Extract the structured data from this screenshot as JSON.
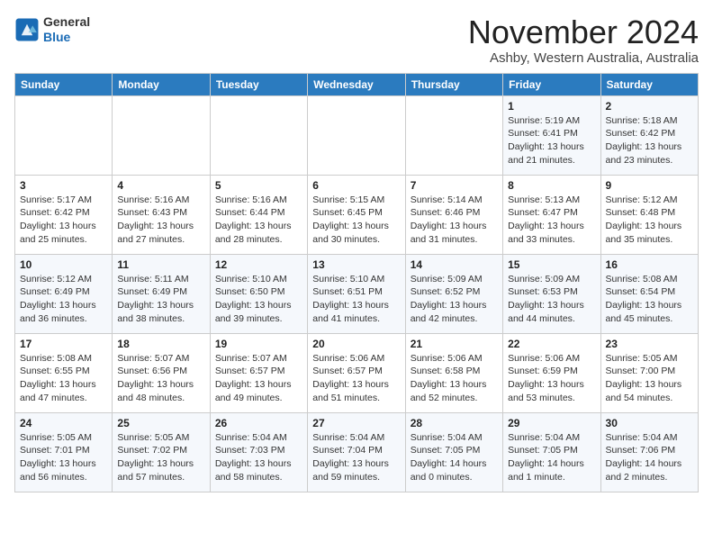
{
  "header": {
    "logo_line1": "General",
    "logo_line2": "Blue",
    "month": "November 2024",
    "location": "Ashby, Western Australia, Australia"
  },
  "days_of_week": [
    "Sunday",
    "Monday",
    "Tuesday",
    "Wednesday",
    "Thursday",
    "Friday",
    "Saturday"
  ],
  "weeks": [
    [
      {
        "day": "",
        "info": ""
      },
      {
        "day": "",
        "info": ""
      },
      {
        "day": "",
        "info": ""
      },
      {
        "day": "",
        "info": ""
      },
      {
        "day": "",
        "info": ""
      },
      {
        "day": "1",
        "info": "Sunrise: 5:19 AM\nSunset: 6:41 PM\nDaylight: 13 hours\nand 21 minutes."
      },
      {
        "day": "2",
        "info": "Sunrise: 5:18 AM\nSunset: 6:42 PM\nDaylight: 13 hours\nand 23 minutes."
      }
    ],
    [
      {
        "day": "3",
        "info": "Sunrise: 5:17 AM\nSunset: 6:42 PM\nDaylight: 13 hours\nand 25 minutes."
      },
      {
        "day": "4",
        "info": "Sunrise: 5:16 AM\nSunset: 6:43 PM\nDaylight: 13 hours\nand 27 minutes."
      },
      {
        "day": "5",
        "info": "Sunrise: 5:16 AM\nSunset: 6:44 PM\nDaylight: 13 hours\nand 28 minutes."
      },
      {
        "day": "6",
        "info": "Sunrise: 5:15 AM\nSunset: 6:45 PM\nDaylight: 13 hours\nand 30 minutes."
      },
      {
        "day": "7",
        "info": "Sunrise: 5:14 AM\nSunset: 6:46 PM\nDaylight: 13 hours\nand 31 minutes."
      },
      {
        "day": "8",
        "info": "Sunrise: 5:13 AM\nSunset: 6:47 PM\nDaylight: 13 hours\nand 33 minutes."
      },
      {
        "day": "9",
        "info": "Sunrise: 5:12 AM\nSunset: 6:48 PM\nDaylight: 13 hours\nand 35 minutes."
      }
    ],
    [
      {
        "day": "10",
        "info": "Sunrise: 5:12 AM\nSunset: 6:49 PM\nDaylight: 13 hours\nand 36 minutes."
      },
      {
        "day": "11",
        "info": "Sunrise: 5:11 AM\nSunset: 6:49 PM\nDaylight: 13 hours\nand 38 minutes."
      },
      {
        "day": "12",
        "info": "Sunrise: 5:10 AM\nSunset: 6:50 PM\nDaylight: 13 hours\nand 39 minutes."
      },
      {
        "day": "13",
        "info": "Sunrise: 5:10 AM\nSunset: 6:51 PM\nDaylight: 13 hours\nand 41 minutes."
      },
      {
        "day": "14",
        "info": "Sunrise: 5:09 AM\nSunset: 6:52 PM\nDaylight: 13 hours\nand 42 minutes."
      },
      {
        "day": "15",
        "info": "Sunrise: 5:09 AM\nSunset: 6:53 PM\nDaylight: 13 hours\nand 44 minutes."
      },
      {
        "day": "16",
        "info": "Sunrise: 5:08 AM\nSunset: 6:54 PM\nDaylight: 13 hours\nand 45 minutes."
      }
    ],
    [
      {
        "day": "17",
        "info": "Sunrise: 5:08 AM\nSunset: 6:55 PM\nDaylight: 13 hours\nand 47 minutes."
      },
      {
        "day": "18",
        "info": "Sunrise: 5:07 AM\nSunset: 6:56 PM\nDaylight: 13 hours\nand 48 minutes."
      },
      {
        "day": "19",
        "info": "Sunrise: 5:07 AM\nSunset: 6:57 PM\nDaylight: 13 hours\nand 49 minutes."
      },
      {
        "day": "20",
        "info": "Sunrise: 5:06 AM\nSunset: 6:57 PM\nDaylight: 13 hours\nand 51 minutes."
      },
      {
        "day": "21",
        "info": "Sunrise: 5:06 AM\nSunset: 6:58 PM\nDaylight: 13 hours\nand 52 minutes."
      },
      {
        "day": "22",
        "info": "Sunrise: 5:06 AM\nSunset: 6:59 PM\nDaylight: 13 hours\nand 53 minutes."
      },
      {
        "day": "23",
        "info": "Sunrise: 5:05 AM\nSunset: 7:00 PM\nDaylight: 13 hours\nand 54 minutes."
      }
    ],
    [
      {
        "day": "24",
        "info": "Sunrise: 5:05 AM\nSunset: 7:01 PM\nDaylight: 13 hours\nand 56 minutes."
      },
      {
        "day": "25",
        "info": "Sunrise: 5:05 AM\nSunset: 7:02 PM\nDaylight: 13 hours\nand 57 minutes."
      },
      {
        "day": "26",
        "info": "Sunrise: 5:04 AM\nSunset: 7:03 PM\nDaylight: 13 hours\nand 58 minutes."
      },
      {
        "day": "27",
        "info": "Sunrise: 5:04 AM\nSunset: 7:04 PM\nDaylight: 13 hours\nand 59 minutes."
      },
      {
        "day": "28",
        "info": "Sunrise: 5:04 AM\nSunset: 7:05 PM\nDaylight: 14 hours\nand 0 minutes."
      },
      {
        "day": "29",
        "info": "Sunrise: 5:04 AM\nSunset: 7:05 PM\nDaylight: 14 hours\nand 1 minute."
      },
      {
        "day": "30",
        "info": "Sunrise: 5:04 AM\nSunset: 7:06 PM\nDaylight: 14 hours\nand 2 minutes."
      }
    ]
  ]
}
